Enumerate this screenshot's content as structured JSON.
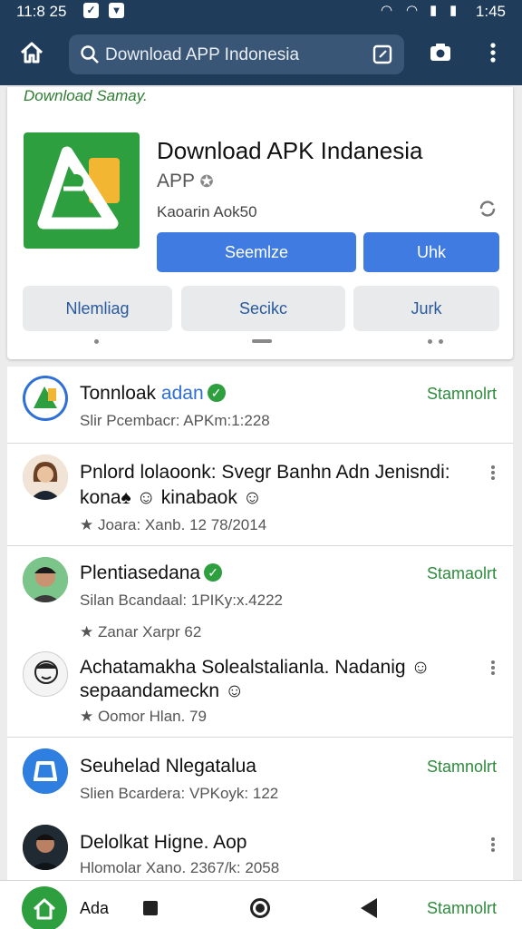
{
  "status_bar": {
    "time_left": "11:8 25",
    "time_right": "1:45"
  },
  "toolbar": {
    "search_text": "Download APP Indonesia"
  },
  "app_card": {
    "tagline": "Download Samay.",
    "title": "Download APK Indanesia",
    "subtitle": "APP",
    "meta": "Kaoarin Aok50",
    "buttons_primary": [
      "Seemlze",
      "Uhk"
    ],
    "buttons_secondary": [
      "Nlemliag",
      "Secikc",
      "Jurk"
    ]
  },
  "list": {
    "items": [
      {
        "title": "Tonnloak",
        "title_accent": "adan",
        "verified": true,
        "subtitle": "Slir Pcembacr: APKm:1:228",
        "action": "Stamnolrt",
        "avatar": "app-logo-blue"
      },
      {
        "title": "Pnlord lolaoonk: Svegr Banhn Adn Jenisndi:",
        "title_line2": "kona♠ ☺ kinabaok ☺",
        "subtitle": "★ Joara: Xanb. 12 78/2014",
        "avatar": "woman-photo",
        "menu": true
      },
      {
        "title": "Plentiasedana",
        "verified": true,
        "subtitle": "Silan Bcandaal: 1PIKy:x.4222",
        "subtitle2": "★ Zanar Xarpr 62",
        "action": "Stamaolrt",
        "avatar": "man-photo-green"
      },
      {
        "title": "Achatamakha Solealstalianla. Nadanig ☺",
        "title_line2": "sepaandameckn ☺",
        "subtitle": "★ Oomor Hlan. 79",
        "avatar": "sketch-face",
        "menu": true
      },
      {
        "title": "Seuhelad Nlegatalua",
        "subtitle": "Slien Bcardera: VPKoyk: 122",
        "action": "Stamnolrt",
        "avatar": "app-logo-car"
      },
      {
        "title": "Delolkat Higne. Aop",
        "subtitle": "Hlomolar Xano. 2367/k: 2058",
        "avatar": "man-photo-dark",
        "menu": true
      }
    ]
  },
  "navbar": {
    "label": "Ada",
    "action": "Stamnolrt"
  },
  "colors": {
    "header": "#1f3c5b",
    "brand_green": "#2e9f3e",
    "primary_blue": "#3f7be0",
    "action_green": "#2e8b3d"
  }
}
